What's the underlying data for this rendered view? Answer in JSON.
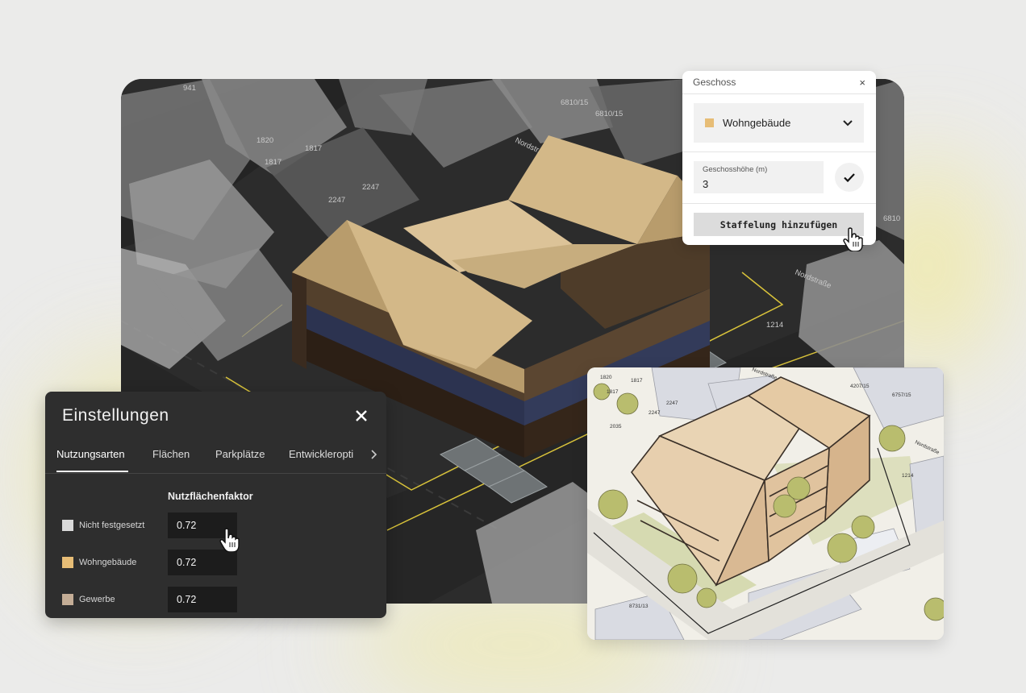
{
  "scene": {
    "parcel_labels": [
      "941",
      "1820",
      "1817",
      "1817",
      "2247",
      "2247",
      "6810/15",
      "6810/15",
      "1214",
      "6810",
      "Nordstr.",
      "Nordstraße",
      "Nordstraße"
    ]
  },
  "geschoss_panel": {
    "title": "Geschoss",
    "close_symbol": "×",
    "usage_select": {
      "value": "Wohngebäude",
      "color": "#e7bd76"
    },
    "height_field": {
      "label": "Geschosshöhe (m)",
      "value": "3"
    },
    "add_button_label": "Staffelung hinzufügen"
  },
  "settings_panel": {
    "title": "Einstellungen",
    "tabs": [
      {
        "label": "Nutzungsarten",
        "active": true
      },
      {
        "label": "Flächen",
        "active": false
      },
      {
        "label": "Parkplätze",
        "active": false
      },
      {
        "label": "Entwickleropti",
        "active": false
      }
    ],
    "column_header": "Nutzflächenfaktor",
    "rows": [
      {
        "label": "Nicht festgesetzt",
        "color": "#d9d9d9",
        "value": "0.72"
      },
      {
        "label": "Wohngebäude",
        "color": "#e7bd76",
        "value": "0.72"
      },
      {
        "label": "Gewerbe",
        "color": "#c4ad96",
        "value": "0.72"
      }
    ]
  },
  "sketch": {
    "labels": [
      "1820",
      "1817",
      "1817",
      "2247",
      "2247",
      "2035",
      "4207/15",
      "6757/15",
      "Nordstraße",
      "1214",
      "8731/13",
      "Nordstraße"
    ]
  },
  "colors": {
    "roof": "#d3b888",
    "floor_brown": "#53402c",
    "floor_blue": "#2c3350",
    "parcel_line": "#d8c23a"
  }
}
